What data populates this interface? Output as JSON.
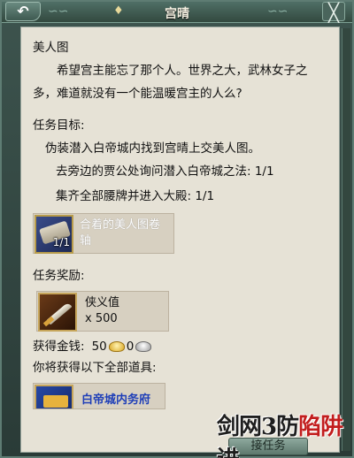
{
  "window": {
    "title": "宫晴",
    "back_glyph": "↶",
    "close_glyph": "╳",
    "pin_glyph": "♦"
  },
  "quest": {
    "name": "美人图",
    "description": "希望宫主能忘了那个人。世界之大，武林女子之多，难道就没有一个能温暖宫主的人么?",
    "objectives_heading": "任务目标:",
    "objectives": [
      "伪装潜入白帝城内找到宫晴上交美人图。",
      "去旁边的贾公处询问潜入白帝城之法: 1/1",
      "集齐全部腰牌并进入大殿: 1/1"
    ],
    "required_item": {
      "icon": "scroll-painting-icon",
      "count": "1/1",
      "name": "合着的美人图卷轴"
    }
  },
  "rewards": {
    "heading": "任务奖励:",
    "item": {
      "icon": "sword-icon",
      "name": "侠义值",
      "qty": "x 500"
    },
    "money_label": "获得金钱:",
    "gold": "50",
    "silver": "0",
    "all_items_label": "你将获得以下全部道具:",
    "bottom_item": {
      "icon": "chest-icon",
      "name": "白帝城内务府"
    }
  },
  "footer": {
    "accept_label": "接任务"
  },
  "watermark": {
    "text_main": "剑网3防",
    "text_red": "陷阱",
    "text_tail": "进"
  },
  "colors": {
    "panel_bg": "#e6e2d6",
    "frame": "#3d544e",
    "item_link": "#1f3fb8"
  }
}
